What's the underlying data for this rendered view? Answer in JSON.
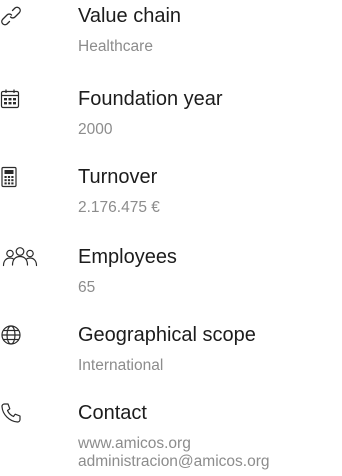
{
  "company_info": {
    "value_chain": {
      "label": "Value chain",
      "value": "Healthcare",
      "icon": "link-icon"
    },
    "foundation_year": {
      "label": "Foundation year",
      "value": "2000",
      "icon": "calendar-icon"
    },
    "turnover": {
      "label": "Turnover",
      "value": "2.176.475 €",
      "icon": "calculator-icon"
    },
    "employees": {
      "label": "Employees",
      "value": "65",
      "icon": "people-icon"
    },
    "geographical_scope": {
      "label": "Geographical scope",
      "value": "International",
      "icon": "globe-icon"
    },
    "contact": {
      "label": "Contact",
      "website": "www.amicos.org",
      "email": "administracion@amicos.org",
      "icon": "phone-icon"
    }
  },
  "colors": {
    "label": "#1c1c1c",
    "value": "#8c8c8c",
    "icon": "#2a2a2a"
  }
}
